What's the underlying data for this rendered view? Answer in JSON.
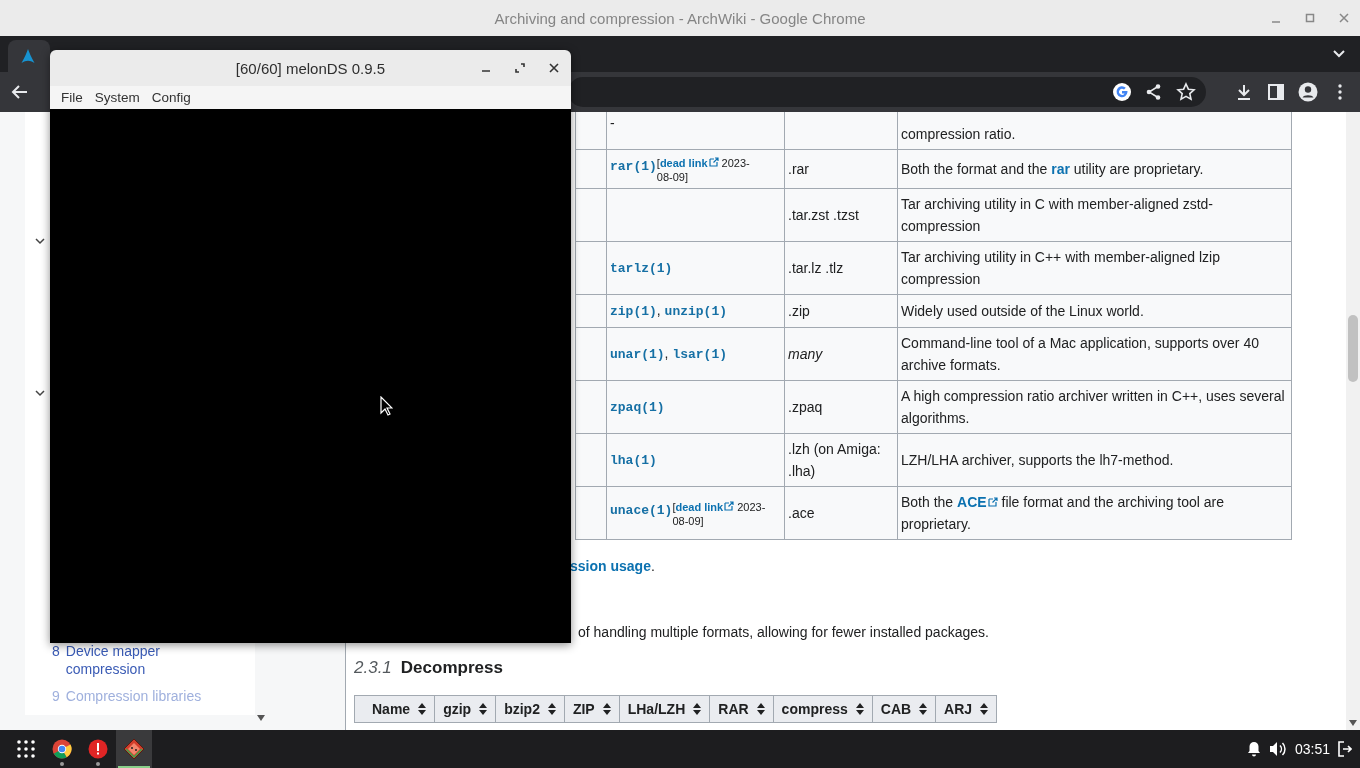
{
  "chrome_window": {
    "title": "Archiving and compression - ArchWiki - Google Chrome"
  },
  "tabs": [
    {
      "selected": true
    }
  ],
  "toc": [
    {
      "number": "8",
      "label": "Device mapper compression",
      "faded": false
    },
    {
      "number": "9",
      "label": "Compression libraries",
      "faded": true
    }
  ],
  "table": {
    "rows": [
      {
        "kind": "clipped",
        "tool": [
          {
            "text": "-"
          }
        ],
        "desc": [
          {
            "text": "compression ratio."
          }
        ]
      },
      {
        "kind": "full",
        "tool": [
          {
            "code": "rar(1)"
          }
        ],
        "note": {
          "before": "[",
          "link": "dead link",
          "after": " 2023-08-09]"
        },
        "ext": ".rar",
        "ext_italic": false,
        "desc": [
          {
            "text": "Both the format and the "
          },
          {
            "link": "rar",
            "external": false
          },
          {
            "text": " utility are proprietary."
          }
        ]
      },
      {
        "kind": "full",
        "tool": [],
        "ext": ".tar.zst .tzst",
        "ext_italic": false,
        "desc": [
          {
            "text": "Tar archiving utility in C with member-aligned zstd-compression"
          }
        ]
      },
      {
        "kind": "full",
        "tool": [
          {
            "code": "tarlz(1)"
          }
        ],
        "ext": ".tar.lz .tlz",
        "ext_italic": false,
        "desc": [
          {
            "text": "Tar archiving utility in C++ with member-aligned lzip compression"
          }
        ]
      },
      {
        "kind": "full",
        "tool": [
          {
            "code": "zip(1)"
          },
          {
            "text": ", "
          },
          {
            "code": "unzip(1)"
          }
        ],
        "ext": ".zip",
        "ext_italic": false,
        "desc": [
          {
            "text": "Widely used outside of the Linux world."
          }
        ]
      },
      {
        "kind": "full",
        "tool": [
          {
            "code": "unar(1)"
          },
          {
            "text": ", "
          },
          {
            "code": "lsar(1)"
          }
        ],
        "ext": "many",
        "ext_italic": true,
        "desc": [
          {
            "text": "Command-line tool of a Mac application, supports over 40 archive formats."
          }
        ]
      },
      {
        "kind": "full",
        "tool": [
          {
            "code": "zpaq(1)"
          }
        ],
        "ext": ".zpaq",
        "ext_italic": false,
        "desc": [
          {
            "text": "A high compression ratio archiver written in C++, uses several algorithms."
          }
        ]
      },
      {
        "kind": "full",
        "tool": [
          {
            "code": "lha(1)"
          }
        ],
        "ext": ".lzh (on Amiga: .lha)",
        "ext_italic": false,
        "desc": [
          {
            "text": "LZH/LHA archiver, supports the lh7-method."
          }
        ]
      },
      {
        "kind": "full",
        "tool": [
          {
            "code": "unace(1)"
          }
        ],
        "note": {
          "before": "[",
          "link": "dead link",
          "after": " 2023-08-09]"
        },
        "ext": ".ace",
        "ext_italic": false,
        "desc": [
          {
            "text": "Both the "
          },
          {
            "link": "ACE",
            "external": true
          },
          {
            "text": " file format and the archiving tool are proprietary."
          }
        ]
      }
    ]
  },
  "see_also": {
    "link": "ssion usage",
    "after": "."
  },
  "paragraph": "of handling multiple formats, allowing for fewer installed packages.",
  "heading": {
    "number": "2.3.1",
    "title": "Decompress"
  },
  "formats_table": {
    "columns": [
      "Name",
      "gzip",
      "bzip2",
      "ZIP",
      "LHa/LZH",
      "RAR",
      "compress",
      "CAB",
      "ARJ"
    ]
  },
  "melonds": {
    "title": "[60/60] melonDS 0.9.5",
    "menu": [
      "File",
      "System",
      "Config"
    ]
  },
  "taskbar": {
    "apps": [
      {
        "kind": "browser",
        "selected": false
      },
      {
        "kind": "alert",
        "selected": false
      },
      {
        "kind": "emulator",
        "selected": true
      }
    ],
    "time": "03:51"
  }
}
